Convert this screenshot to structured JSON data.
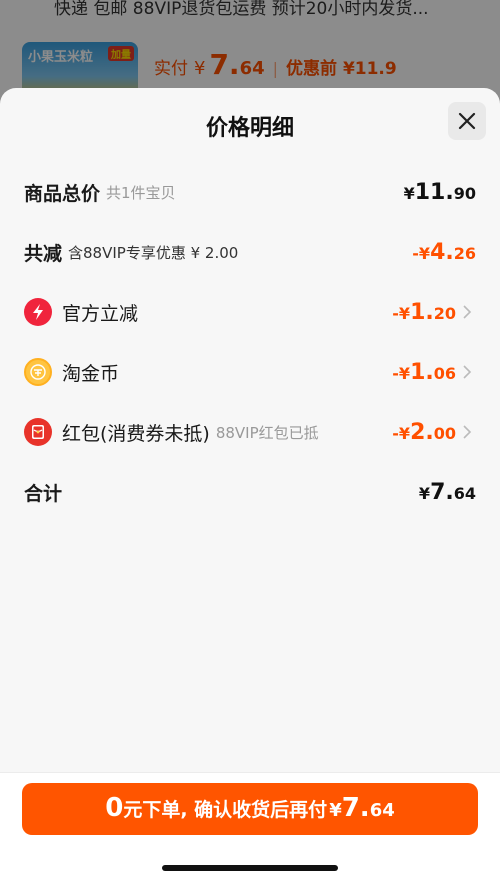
{
  "background": {
    "shipping_text": "快递 包邮 88VIP退货包运费 预计20小时内发货...",
    "product_thumb_title": "小果玉米粒",
    "product_thumb_tag": "加量",
    "actual_label": "实付",
    "actual_currency": "¥",
    "actual_int": "7.",
    "actual_dec": "64",
    "before_text": "优惠前 ¥11.9"
  },
  "sheet": {
    "title": "价格明细",
    "rows": [
      {
        "label": "商品总价",
        "note": "共1件宝贝",
        "currency": "¥",
        "int": "11.",
        "dec": "90"
      },
      {
        "label": "共减",
        "note": "含88VIP专享优惠 ¥ 2.00",
        "currency": "-¥",
        "int": "4.",
        "dec": "26"
      },
      {
        "label": "官方立减",
        "note": "",
        "currency": "-¥",
        "int": "1.",
        "dec": "20",
        "icon": "lightning-icon"
      },
      {
        "label": "淘金币",
        "note": "",
        "currency": "-¥",
        "int": "1.",
        "dec": "06",
        "icon": "coin-icon"
      },
      {
        "label": "红包(消费券未抵)",
        "note": "88VIP红包已抵",
        "currency": "-¥",
        "int": "2.",
        "dec": "00",
        "icon": "red-packet-icon"
      },
      {
        "label": "合计",
        "note": "",
        "currency": "¥",
        "int": "7.",
        "dec": "64"
      }
    ]
  },
  "cta": {
    "zero": "0",
    "text": "元下单, 确认收货后再付",
    "currency": "¥",
    "int": "7.",
    "dec": "64"
  },
  "colors": {
    "accent": "#ff5000",
    "cta_bg": "#ff5500",
    "lightning_icon": "#f0243c",
    "coin_icon": "#ffc440",
    "red_packet_icon": "#e8332a"
  }
}
